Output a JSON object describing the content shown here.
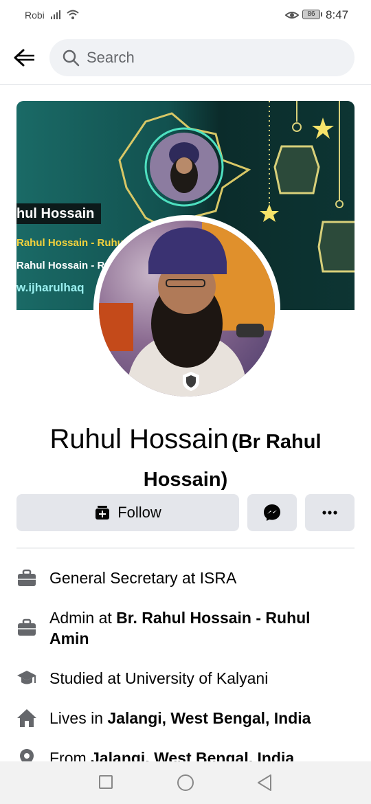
{
  "status_bar": {
    "carrier": "Robi",
    "battery": "86",
    "time": "8:47"
  },
  "search": {
    "placeholder": "Search"
  },
  "cover": {
    "badge": "hul Hossain",
    "line1": "Rahul Hossain - Ruhu",
    "line2": "Rahul Hossain - R",
    "line3": "w.ijharulhaq"
  },
  "profile": {
    "name": "Ruhul Hossain",
    "alt_name": "(Br Rahul Hossain)"
  },
  "actions": {
    "follow_label": "Follow"
  },
  "about": [
    {
      "icon": "briefcase-icon",
      "text": "General Secretary at ISRA"
    },
    {
      "icon": "briefcase-icon",
      "prefix": "Admin at ",
      "bold": "Br. Rahul Hossain - Ruhul Amin"
    },
    {
      "icon": "graduation-cap-icon",
      "text": "Studied at University of Kalyani"
    },
    {
      "icon": "home-icon",
      "prefix": "Lives in ",
      "bold": "Jalangi, West Bengal, India"
    },
    {
      "icon": "location-pin-icon",
      "prefix": "From ",
      "bold": "Jalangi, West Bengal, India"
    }
  ]
}
